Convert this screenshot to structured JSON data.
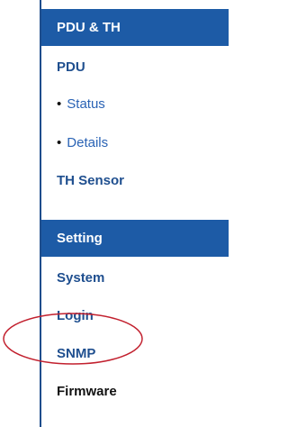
{
  "sidebar": {
    "section_pdu": {
      "header": "PDU & TH",
      "items": [
        {
          "label": "PDU"
        },
        {
          "label": "Status"
        },
        {
          "label": "Details"
        },
        {
          "label": "TH Sensor"
        }
      ]
    },
    "section_setting": {
      "header": "Setting",
      "items": [
        {
          "label": "System"
        },
        {
          "label": "Login"
        },
        {
          "label": "SNMP"
        },
        {
          "label": "Firmware"
        }
      ]
    }
  },
  "colors": {
    "header_bg": "#1d5ba6",
    "link": "#1f4f8f",
    "sub_link": "#2a63b5",
    "annotation_oval": "#c2202e"
  }
}
